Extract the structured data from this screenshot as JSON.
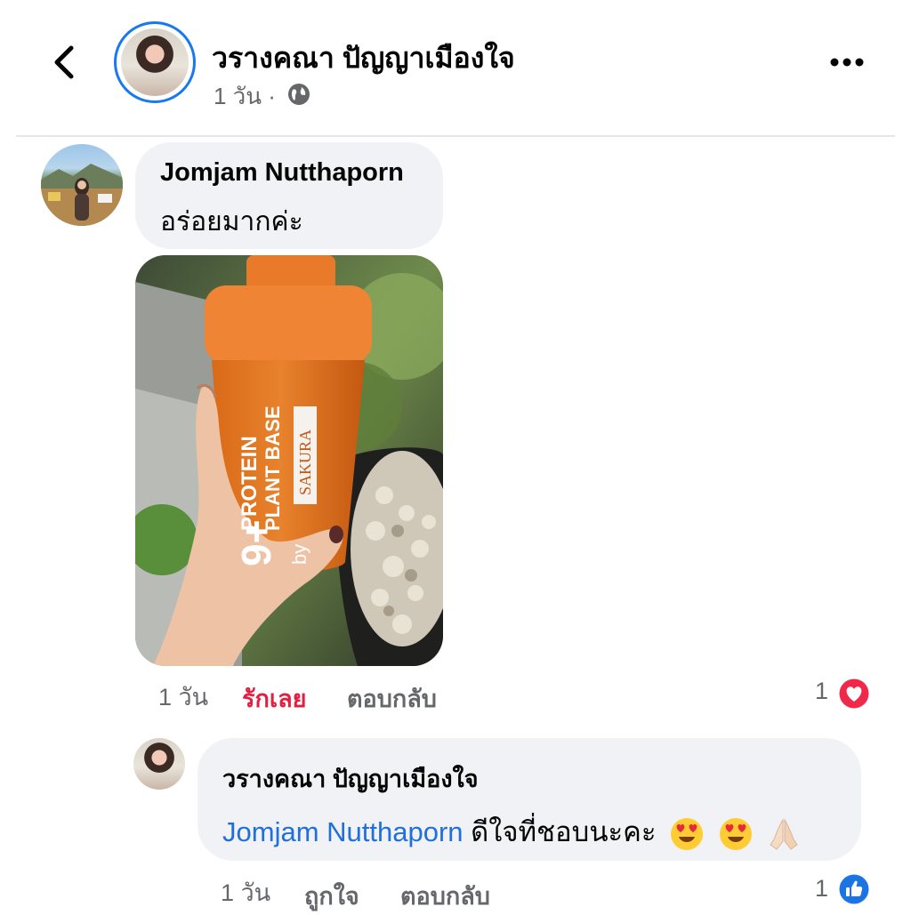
{
  "header": {
    "author_name": "วรางคณา ปัญญาเมืองใจ",
    "post_time": "1 วัน ·",
    "icons": [
      "back-icon",
      "globe-icon",
      "more-icon"
    ]
  },
  "comment": {
    "author": "Jomjam Nutthaporn",
    "text": "อร่อยมากค่ะ",
    "photo": {
      "cup_text_line1": "PROTEIN",
      "cup_text_line2": "PLANT BASE",
      "cup_brand": "SAKURA",
      "cup_by": "by",
      "cup_mark": "9+"
    },
    "time": "1 วัน",
    "love_label": "รักเลย",
    "reply_label": "ตอบกลับ",
    "reaction_count": "1",
    "reaction_icon": "love-icon"
  },
  "reply": {
    "author": "วรางคณา ปัญญาเมืองใจ",
    "mention": "Jomjam Nutthaporn",
    "text": "ดีใจที่ชอบนะคะ",
    "emojis": [
      "heart-eyes-icon",
      "heart-eyes-icon",
      "folded-hands-icon"
    ],
    "time": "1 วัน",
    "like_label": "ถูกใจ",
    "reply_label": "ตอบกลับ",
    "reaction_count": "1",
    "reaction_icon": "like-icon"
  },
  "colors": {
    "accent_blue": "#1877f2",
    "love_red": "#e41e3f",
    "mention_blue": "#216fdb",
    "bubble_gray": "#f0f2f5",
    "meta_gray": "#65676b"
  }
}
